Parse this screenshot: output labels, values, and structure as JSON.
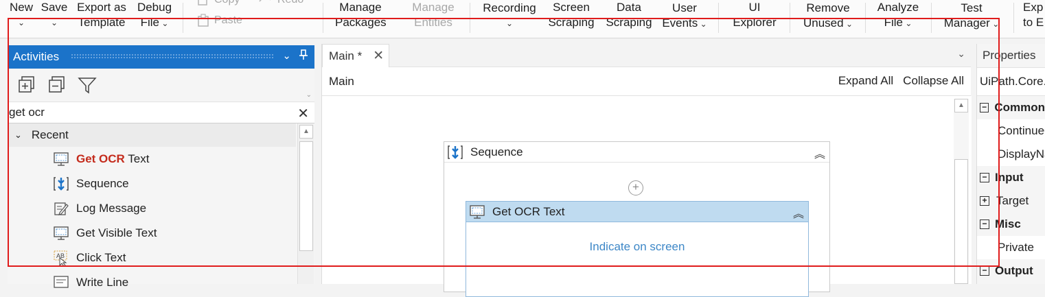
{
  "ribbon": {
    "new": {
      "l1": "New",
      "l2": "⌄"
    },
    "save": {
      "l1": "Save",
      "l2": "⌄"
    },
    "export_template": {
      "l1": "Export as",
      "l2": "Template"
    },
    "debug_file": {
      "l1": "Debug",
      "l2": "File"
    },
    "copy": "Copy",
    "redo": "Redo",
    "paste": "Paste",
    "manage_packages": {
      "l1": "Manage",
      "l2": "Packages"
    },
    "manage_entities": {
      "l1": "Manage",
      "l2": "Entities"
    },
    "recording": {
      "l1": "Recording",
      "l2": "⌄"
    },
    "screen_scraping": {
      "l1": "Screen",
      "l2": "Scraping"
    },
    "data_scraping": {
      "l1": "Data",
      "l2": "Scraping"
    },
    "user_events": {
      "l1": "User",
      "l2": "Events"
    },
    "ui_explorer": {
      "l1": "UI",
      "l2": "Explorer"
    },
    "remove_unused": {
      "l1": "Remove",
      "l2": "Unused"
    },
    "analyze_file": {
      "l1": "Analyze",
      "l2": "File"
    },
    "test_manager": {
      "l1": "Test",
      "l2": "Manager"
    },
    "export": {
      "l1": "Exp",
      "l2": "to E"
    }
  },
  "activities": {
    "title": "Activities",
    "search_value": "get ocr",
    "group": "Recent",
    "items": [
      {
        "highlight": "Get OCR",
        "rest": " Text"
      },
      {
        "highlight": "",
        "rest": "Sequence"
      },
      {
        "highlight": "",
        "rest": "Log Message"
      },
      {
        "highlight": "",
        "rest": "Get Visible Text"
      },
      {
        "highlight": "",
        "rest": "Click Text"
      },
      {
        "highlight": "",
        "rest": "Write Line"
      }
    ]
  },
  "designer": {
    "tab_label": "Main *",
    "breadcrumb": "Main",
    "expand_all": "Expand All",
    "collapse_all": "Collapse All",
    "sequence_title": "Sequence",
    "ocr_title": "Get OCR Text",
    "indicate_text": "Indicate on screen"
  },
  "properties": {
    "title": "Properties",
    "type": "UiPath.Core.Activities.GetOCRText",
    "common": "Common",
    "continue": "ContinueOnError",
    "display": "DisplayName",
    "input": "Input",
    "target": "Target",
    "misc": "Misc",
    "private": "Private",
    "output": "Output"
  },
  "colors": {
    "accent": "#1b73c9",
    "highlight": "#c42b1c",
    "activity_header": "#bfdbf0",
    "link": "#3d87c7",
    "annotation": "#e01b1b"
  }
}
